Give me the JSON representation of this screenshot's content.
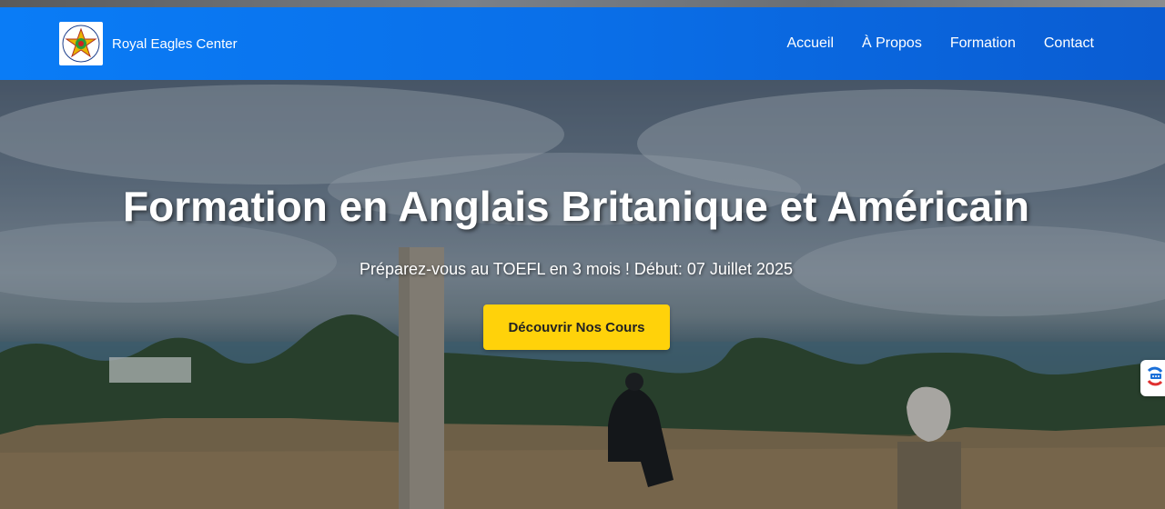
{
  "brand": {
    "name": "Royal Eagles Center",
    "logo_text": "CENTER ROYAL EAGLES"
  },
  "nav": {
    "items": [
      {
        "label": "Accueil"
      },
      {
        "label": "À Propos"
      },
      {
        "label": "Formation"
      },
      {
        "label": "Contact"
      }
    ]
  },
  "hero": {
    "title": "Formation en Anglais Britanique et Américain",
    "subtitle": "Préparez-vous au TOEFL en 3 mois ! Début: 07 Juillet 2025",
    "cta_label": "Découvrir Nos Cours",
    "background": "photo of ancient ruins with column overlooking sea"
  },
  "widget": {
    "icon": "translate-icon"
  },
  "colors": {
    "navbar": "#0a6fe8",
    "cta": "#ffd20a",
    "text_light": "#ffffff"
  }
}
